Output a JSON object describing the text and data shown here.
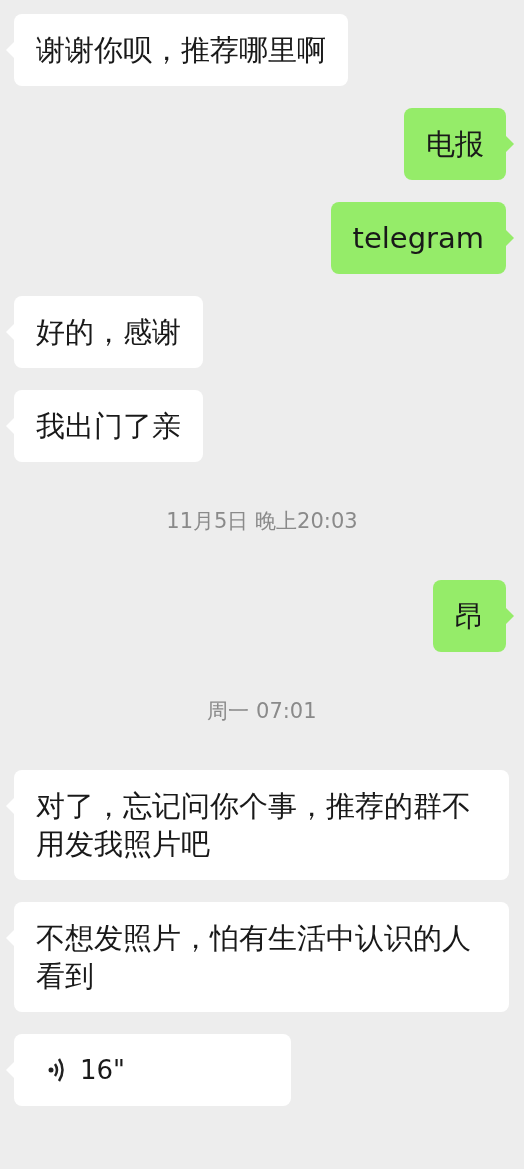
{
  "messages": [
    {
      "kind": "received",
      "text": "谢谢你呗，推荐哪里啊"
    },
    {
      "kind": "sent",
      "text": "电报"
    },
    {
      "kind": "sent",
      "text": "telegram"
    },
    {
      "kind": "received",
      "text": "好的，感谢"
    },
    {
      "kind": "received",
      "text": "我出门了亲"
    },
    {
      "kind": "time",
      "text": "11月5日 晚上20:03"
    },
    {
      "kind": "sent",
      "text": "昂"
    },
    {
      "kind": "time",
      "text": "周一 07:01"
    },
    {
      "kind": "received",
      "text": "对了，忘记问你个事，推荐的群不用发我照片吧"
    },
    {
      "kind": "received",
      "text": "不想发照片，怕有生活中认识的人看到"
    },
    {
      "kind": "voice_received",
      "text": "16\""
    }
  ]
}
